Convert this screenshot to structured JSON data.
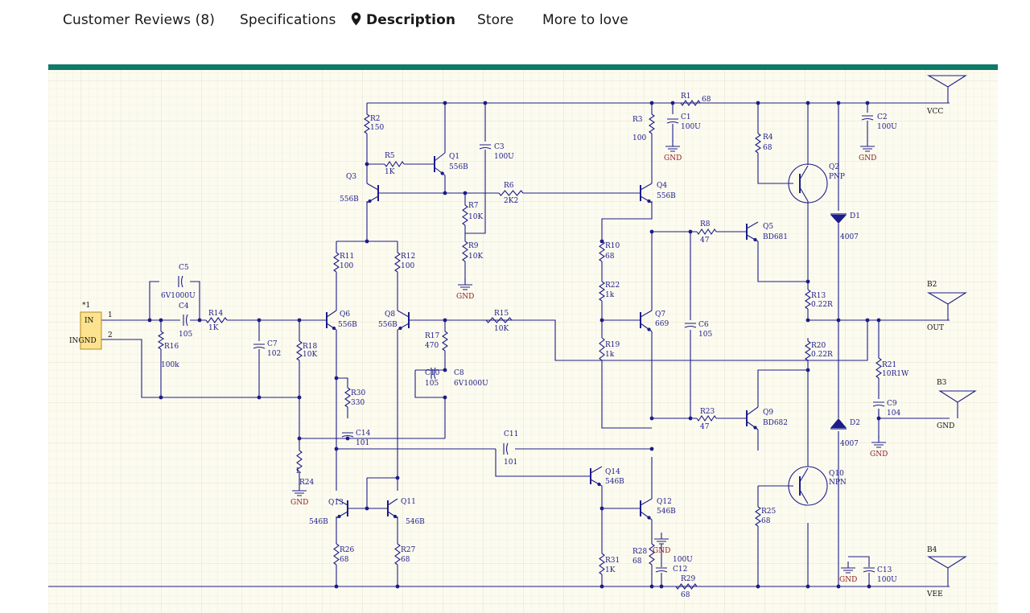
{
  "tabs": [
    {
      "label": "Customer Reviews (8)",
      "active": false
    },
    {
      "label": "Specifications",
      "active": false
    },
    {
      "label": "Description",
      "active": true,
      "icon": "location-pin-icon"
    },
    {
      "label": "Store",
      "active": false
    },
    {
      "label": "More to love",
      "active": false
    }
  ],
  "colors": {
    "accent_bar": "#0f7a67",
    "schematic_bg": "#fcfbf0",
    "wire": "#1c1c8a",
    "component_text": "#1c1c8a",
    "ground_text": "#8a1c1c",
    "connector_fill": "#fde28f"
  },
  "schematic": {
    "nets": {
      "vcc": "VCC",
      "vee": "VEE",
      "out": "OUT",
      "gnd": "GND"
    },
    "ports": {
      "b2": "B2",
      "b3": "B3",
      "b4": "B4"
    },
    "connector": {
      "designator": "*1",
      "pin_in": "IN",
      "pin_ingnd": "INGND",
      "pin1": "1",
      "pin2": "2"
    },
    "components": {
      "r1": {
        "ref": "R1",
        "val": "68"
      },
      "r2": {
        "ref": "R2",
        "val": "150"
      },
      "r3": {
        "ref": "R3",
        "val": "100"
      },
      "r4": {
        "ref": "R4",
        "val": "68"
      },
      "r5": {
        "ref": "R5",
        "val": "1K"
      },
      "r6": {
        "ref": "R6",
        "val": "2K2"
      },
      "r7": {
        "ref": "R7",
        "val": "10K"
      },
      "r8": {
        "ref": "R8",
        "val": "47"
      },
      "r9": {
        "ref": "R9",
        "val": "10K"
      },
      "r10": {
        "ref": "R10",
        "val": "68"
      },
      "r11": {
        "ref": "R11",
        "val": "100"
      },
      "r12": {
        "ref": "R12",
        "val": "100"
      },
      "r13": {
        "ref": "R13",
        "val": "0.22R"
      },
      "r14": {
        "ref": "R14",
        "val": "1K"
      },
      "r15": {
        "ref": "R15",
        "val": "10K"
      },
      "r16": {
        "ref": "R16",
        "val": "100k"
      },
      "r17": {
        "ref": "R17",
        "val": "470"
      },
      "r18": {
        "ref": "R18",
        "val": "10K"
      },
      "r19": {
        "ref": "R19",
        "val": "1k"
      },
      "r20": {
        "ref": "R20",
        "val": "0.22R"
      },
      "r21": {
        "ref": "R21",
        "val": "10R1W"
      },
      "r22": {
        "ref": "R22",
        "val": "1k"
      },
      "r23": {
        "ref": "R23",
        "val": "47"
      },
      "r24": {
        "ref": "R24",
        "val": "L"
      },
      "r25": {
        "ref": "R25",
        "val": "68"
      },
      "r26": {
        "ref": "R26",
        "val": "68"
      },
      "r27": {
        "ref": "R27",
        "val": "68"
      },
      "r28": {
        "ref": "R28",
        "val": "68"
      },
      "r29": {
        "ref": "R29",
        "val": "68"
      },
      "r30": {
        "ref": "R30",
        "val": "330"
      },
      "r31": {
        "ref": "R31",
        "val": "1K"
      },
      "c1": {
        "ref": "C1",
        "val": "100U"
      },
      "c2": {
        "ref": "C2",
        "val": "100U"
      },
      "c3": {
        "ref": "C3",
        "val": "100U"
      },
      "c4": {
        "ref": "C4",
        "val": "105"
      },
      "c5": {
        "ref": "C5",
        "val": "6V1000U"
      },
      "c6": {
        "ref": "C6",
        "val": "105"
      },
      "c7": {
        "ref": "C7",
        "val": "102"
      },
      "c8": {
        "ref": "C8",
        "val": "6V1000U"
      },
      "c9": {
        "ref": "C9",
        "val": "104"
      },
      "c10": {
        "ref": "C10",
        "val": "105"
      },
      "c11": {
        "ref": "C11",
        "val": "101"
      },
      "c12": {
        "ref": "C12",
        "val": "100U"
      },
      "c13": {
        "ref": "C13",
        "val": "100U"
      },
      "c14": {
        "ref": "C14",
        "val": "101"
      },
      "q1": {
        "ref": "Q1",
        "val": "556B"
      },
      "q2": {
        "ref": "Q2",
        "val": "PNP"
      },
      "q3": {
        "ref": "Q3",
        "val": "556B"
      },
      "q4": {
        "ref": "Q4",
        "val": "556B"
      },
      "q5": {
        "ref": "Q5",
        "val": "BD681"
      },
      "q6": {
        "ref": "Q6",
        "val": "556B"
      },
      "q7": {
        "ref": "Q7",
        "val": "669"
      },
      "q8": {
        "ref": "Q8",
        "val": "556B"
      },
      "q9": {
        "ref": "Q9",
        "val": "BD682"
      },
      "q10": {
        "ref": "Q10",
        "val": "NPN"
      },
      "q11": {
        "ref": "Q11",
        "val": "546B"
      },
      "q12": {
        "ref": "Q12",
        "val": "546B"
      },
      "q13": {
        "ref": "Q13",
        "val": "546B"
      },
      "q14": {
        "ref": "Q14",
        "val": "546B"
      },
      "d1": {
        "ref": "D1",
        "val": "4007"
      },
      "d2": {
        "ref": "D2",
        "val": "4007"
      }
    }
  }
}
